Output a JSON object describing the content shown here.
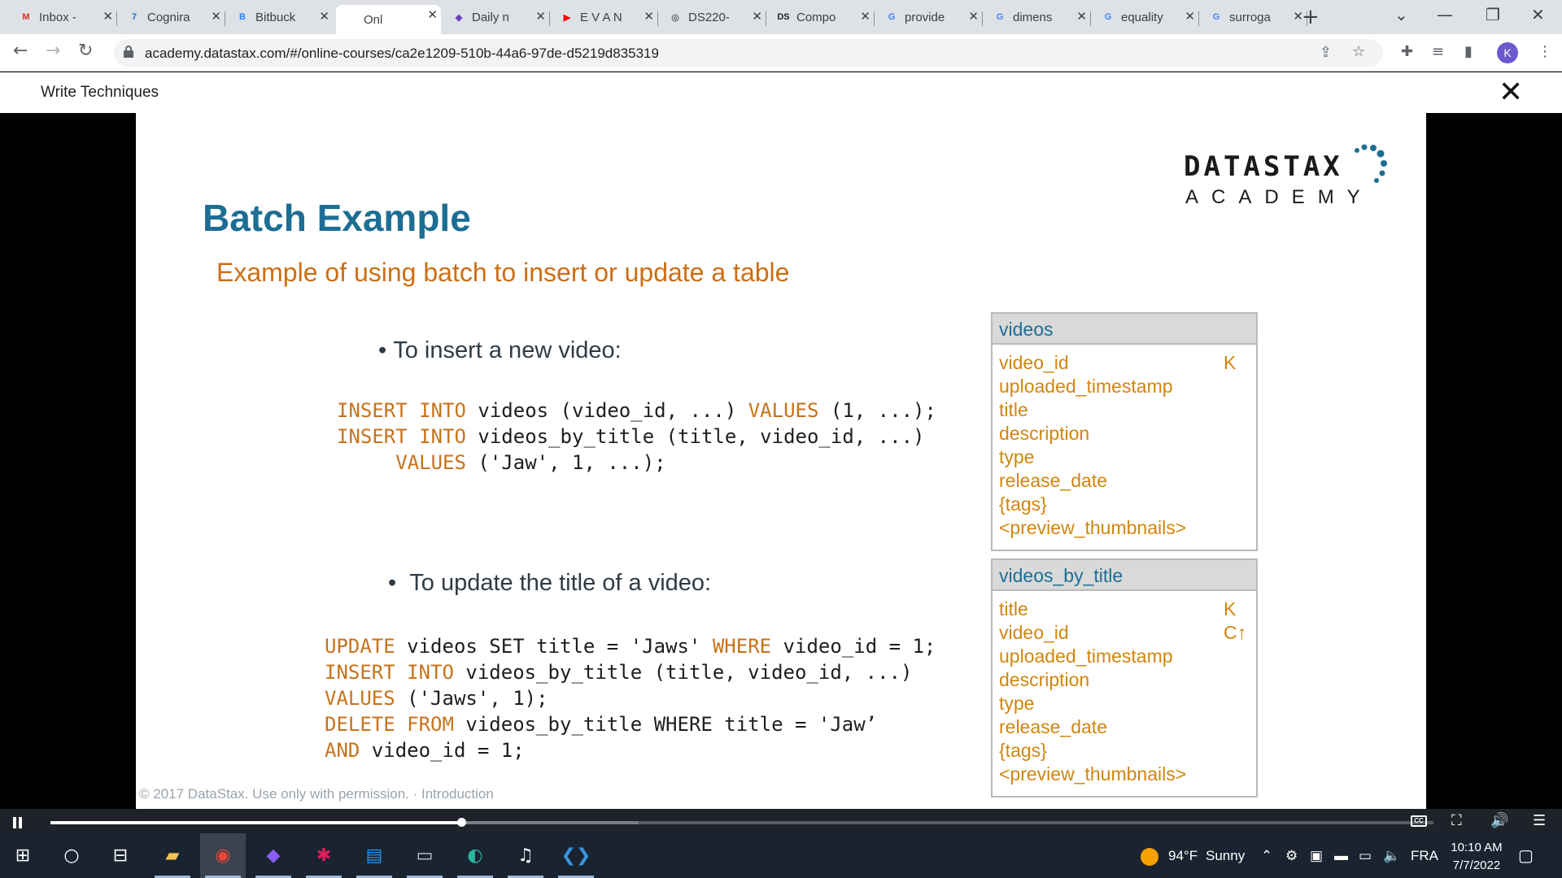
{
  "browser": {
    "tabs": [
      {
        "label": "Inbox -",
        "fav": "M",
        "color": "#d93025"
      },
      {
        "label": "Cognira",
        "fav": "7",
        "color": "#1a73e8"
      },
      {
        "label": "Bitbuck",
        "fav": "B",
        "color": "#2684ff"
      },
      {
        "label": "Onl",
        "fav": "∴",
        "color": "#ffffff"
      },
      {
        "label": "Daily n",
        "fav": "◆",
        "color": "#6a3fbf"
      },
      {
        "label": "E V A N",
        "fav": "▶",
        "color": "#ff0000"
      },
      {
        "label": "DS220-",
        "fav": "◎",
        "color": "#5f6368"
      },
      {
        "label": "Compo",
        "fav": "DS",
        "color": "#202124"
      },
      {
        "label": "provide",
        "fav": "G",
        "color": "#4285f4"
      },
      {
        "label": "dimens",
        "fav": "G",
        "color": "#4285f4"
      },
      {
        "label": "equality",
        "fav": "G",
        "color": "#4285f4"
      },
      {
        "label": "surroga",
        "fav": "G",
        "color": "#4285f4"
      }
    ],
    "url": "academy.datastax.com/#/online-courses/ca2e1209-510b-44a6-97de-d5219d835319",
    "profile_initial": "K"
  },
  "course": {
    "title": "Write Techniques"
  },
  "slide": {
    "logo_word": "DATASTAX",
    "logo_sub": "ACADEMY",
    "title": "Batch Example",
    "subtitle": "Example of using batch to insert or update a table",
    "bullet_insert": "To insert a new video:",
    "bullet_update": "To update the title of a video:",
    "insert_code": [
      [
        {
          "t": "INSERT INTO",
          "k": true
        },
        {
          "t": " videos (video_id, ...) ",
          "k": false
        },
        {
          "t": "VALUES",
          "k": true
        },
        {
          "t": " (1, ...);",
          "k": false
        }
      ],
      [
        {
          "t": "INSERT INTO",
          "k": true
        },
        {
          "t": " videos_by_title (title, video_id, ...)",
          "k": false
        }
      ],
      [
        {
          "t": "     VALUES",
          "k": true
        },
        {
          "t": " ('Jaw', 1, ...);",
          "k": false
        }
      ]
    ],
    "update_code": [
      [
        {
          "t": "UPDATE",
          "k": true
        },
        {
          "t": " videos SET title = 'Jaws' ",
          "k": false
        },
        {
          "t": "WHERE",
          "k": true
        },
        {
          "t": " video_id = 1;",
          "k": false
        }
      ],
      [
        {
          "t": "INSERT INTO",
          "k": true
        },
        {
          "t": " videos_by_title (title, video_id, ...)",
          "k": false
        }
      ],
      [
        {
          "t": "VALUES",
          "k": true
        },
        {
          "t": " ('Jaws', 1);",
          "k": false
        }
      ],
      [
        {
          "t": "DELETE FROM",
          "k": true
        },
        {
          "t": " videos_by_title WHERE title = 'Jaw’",
          "k": false
        }
      ],
      [
        {
          "t": "AND",
          "k": true
        },
        {
          "t": " video_id = 1;",
          "k": false
        }
      ]
    ],
    "tables": [
      {
        "name": "videos",
        "columns": [
          {
            "name": "video_id",
            "key": "K"
          },
          {
            "name": "uploaded_timestamp",
            "key": ""
          },
          {
            "name": "title",
            "key": ""
          },
          {
            "name": "description",
            "key": ""
          },
          {
            "name": "type",
            "key": ""
          },
          {
            "name": "release_date",
            "key": ""
          },
          {
            "name": "{tags}",
            "key": ""
          },
          {
            "name": "<preview_thumbnails>",
            "key": ""
          }
        ]
      },
      {
        "name": "videos_by_title",
        "columns": [
          {
            "name": "title",
            "key": "K"
          },
          {
            "name": "video_id",
            "key": "C↑"
          },
          {
            "name": "uploaded_timestamp",
            "key": ""
          },
          {
            "name": "description",
            "key": ""
          },
          {
            "name": "type",
            "key": ""
          },
          {
            "name": "release_date",
            "key": ""
          },
          {
            "name": "{tags}",
            "key": ""
          },
          {
            "name": "<preview_thumbnails>",
            "key": ""
          }
        ]
      }
    ],
    "footer": "© 2017 DataStax. Use only with permission. · Introduction",
    "footer_logo": "DATASTAX"
  },
  "player": {
    "progress_fraction": 0.297,
    "buffered_fraction": 0.425
  },
  "taskbar": {
    "weather_temp": "94°F",
    "weather_desc": "Sunny",
    "language": "FRA",
    "time": "10:10 AM",
    "date": "7/7/2022"
  },
  "colors": {
    "title_blue": "#1d6e94",
    "accent_orange": "#cc6e14",
    "keyword_orange": "#c6731d",
    "column_gold": "#d0860e"
  }
}
